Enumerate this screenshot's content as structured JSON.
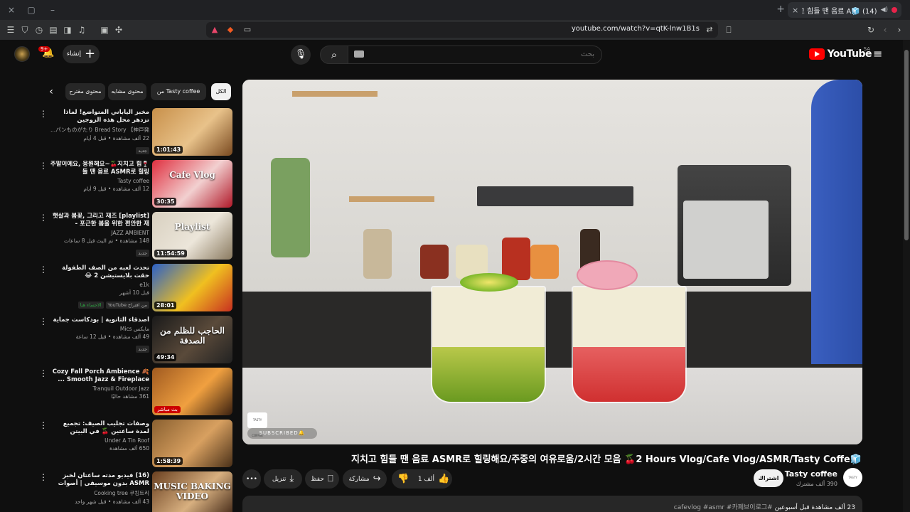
{
  "browser": {
    "tab": {
      "title": "(14) 🧊지치고 힘들 땐 음료 A",
      "close": "×",
      "new_tab": "+"
    },
    "url": "youtube.com/watch?v=qtK-lnw1B1s",
    "window_controls": [
      "–",
      "▢",
      "×"
    ]
  },
  "masthead": {
    "logo": "YouTube",
    "country": "SA",
    "search_placeholder": "بحث",
    "create_label": "إنشاء",
    "notification_count": "9+"
  },
  "video": {
    "title": "🧊지치고 힘들 땐 음료 ASMR로 힐링해요/주중의 여유로움/2시간 모음 🍒2 Hours Vlog/Cafe Vlog/ASMR/Tasty Coffe",
    "watermark": "TASTY COFFEE",
    "subscribed_overlay": "SUBSCRIBED🔔",
    "channel": {
      "name": "Tasty coffee",
      "subs": "390 ألف مشترك",
      "subscribe_label": "اشتراك"
    },
    "actions": {
      "like_count": "1 ألف",
      "share": "مشاركة",
      "save": "حفظ",
      "download": "تنزيل",
      "more": "•••"
    },
    "description": {
      "stats": "23 ألف مشاهدة قبل أسبوعين",
      "tags": "#cafevlog #asmr #카페브이로그"
    }
  },
  "chips": {
    "items": [
      "الكل",
      "من Tasty coffee",
      "محتوى مشابه",
      "محتوى مقترح"
    ],
    "active_index": 0
  },
  "recommendations": [
    {
      "title": "مخبز الياباني المتواضع! لماذا تزدهر محل هذه الزوجين المحليين من الساعة 2 صباحًا لمدة ...",
      "channel": "パンものがたり Bread Story 【神戸発...",
      "meta": "22 ألف مشاهدة • قبل 4 أيام",
      "badge": "جديد",
      "duration": "1:01:43",
      "thumb_colors": [
        "#c8904a",
        "#e8c28a",
        "#7a4a20"
      ]
    },
    {
      "title": "🍷주말이에요, 응원해요~🍒지치고 힘들 땐 음료 ASMR로 힐링",
      "channel": "Tasty coffee",
      "meta": "12 ألف مشاهدة • قبل 9 أيام",
      "badge": "",
      "duration": "30:35",
      "thumb_text": "Cafe Vlog",
      "thumb_colors": [
        "#e03040",
        "#f2d0d0",
        "#b01828"
      ]
    },
    {
      "title": "[playlist] 햇살과 봄꽃, 그리고 재즈 - 포근한 봄을 위한 편안한 재",
      "channel": "JAZZ AMBIENT",
      "meta": "148 مشاهدة • تم البث قبل 8 ساعات",
      "badge": "جديد",
      "duration": "11:54:59",
      "thumb_text": "Playlist",
      "thumb_colors": [
        "#d8d0c0",
        "#ece6da",
        "#8a7a60"
      ]
    },
    {
      "title": "تحدث لعبه من الصف الطفولة حقت بلايستيشن 2 😂",
      "channel": "e1k",
      "meta": "قبل 10 أشهر",
      "badge": "من اقتراح YouTube",
      "badge2": "الاحساء هنا",
      "duration": "28:01",
      "thumb_colors": [
        "#2a60c8",
        "#f0c020",
        "#c83020"
      ]
    },
    {
      "title": "أصدقاء الثانوية | بودكاست جماية",
      "channel": "مايكس Mics",
      "meta": "49 ألف مشاهدة • قبل 12 ساعة",
      "badge": "جديد",
      "duration": "49:34",
      "thumb_text": "الحاجب للظلم من الصدفة",
      "thumb_colors": [
        "#1a1a1a",
        "#5a4a3a",
        "#222"
      ]
    },
    {
      "title": "Cozy Fall Porch Ambience 🍂 Smooth Jazz & Fireplace ...",
      "channel": "Tranquil Outdoor Jazz",
      "meta": "361 مشاهد حاليًا",
      "badge": "",
      "live": "بث مباشر",
      "duration": "",
      "thumb_colors": [
        "#a05a20",
        "#f0a040",
        "#3a2010"
      ]
    },
    {
      "title": "وصفات تجليب الصيف: تجميع لمدة ساعتين 🍒 في البيتن البطيء في الريف",
      "channel": "Under A Tin Roof",
      "meta": "650 ألف مشاهدة",
      "badge": "",
      "duration": "1:58:39",
      "thumb_colors": [
        "#8a6030",
        "#d8a060",
        "#4a3018"
      ]
    },
    {
      "title": "(16) فيديو مدته ساعتان لخبز ASMR بدون موسيقى | أصوات نوم مريحة | كعكة، كعكة ...",
      "channel": "Cooking tree 쿠킹트리",
      "meta": "43 ألف مشاهدة • قبل شهر واحد",
      "badge": "",
      "duration": "",
      "thumb_text": "MUSIC BAKING VIDEO",
      "thumb_colors": [
        "#6a4020",
        "#d8b080",
        "#3a2010"
      ]
    }
  ],
  "colors": {
    "accent": "#ff0000",
    "background": "#0f0f0f",
    "surface": "#272727",
    "text_secondary": "#aaaaaa"
  }
}
